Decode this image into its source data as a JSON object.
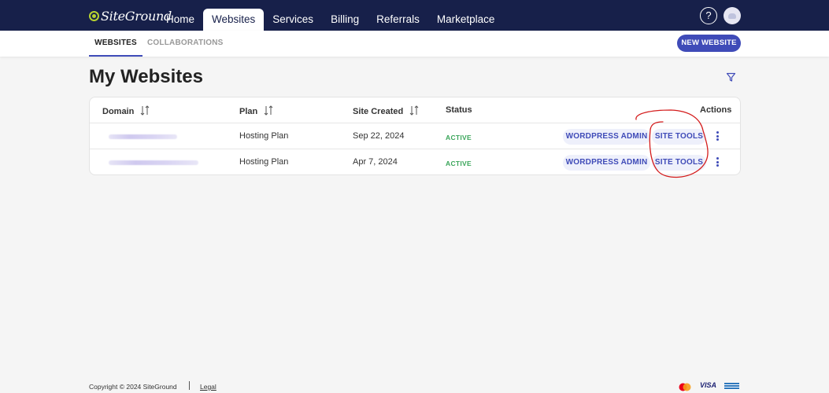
{
  "brand": {
    "name": "SiteGround"
  },
  "nav": {
    "items": [
      {
        "label": "Home",
        "active": false
      },
      {
        "label": "Websites",
        "active": true
      },
      {
        "label": "Services",
        "active": false
      },
      {
        "label": "Billing",
        "active": false
      },
      {
        "label": "Referrals",
        "active": false
      },
      {
        "label": "Marketplace",
        "active": false
      }
    ],
    "help_icon": "question-circle-icon",
    "help_glyph": "?",
    "avatar_icon": "user-avatar-icon"
  },
  "subnav": {
    "tabs": [
      {
        "label": "WEBSITES",
        "active": true
      },
      {
        "label": "COLLABORATIONS",
        "active": false
      }
    ],
    "new_button": "NEW WEBSITE"
  },
  "page": {
    "title": "My Websites",
    "filter_icon": "filter-icon"
  },
  "table": {
    "headers": {
      "domain": "Domain",
      "plan": "Plan",
      "created": "Site Created",
      "status": "Status",
      "actions": "Actions"
    },
    "rows": [
      {
        "domain": "",
        "plan": "Hosting Plan",
        "created": "Sep 22, 2024",
        "status": "ACTIVE",
        "wp_admin": "WORDPRESS ADMIN",
        "site_tools": "SITE TOOLS"
      },
      {
        "domain": "",
        "plan": "Hosting Plan",
        "created": "Apr 7, 2024",
        "status": "ACTIVE",
        "wp_admin": "WORDPRESS ADMIN",
        "site_tools": "SITE TOOLS"
      }
    ]
  },
  "footer": {
    "copyright": "Copyright © 2024 SiteGround",
    "legal": "Legal",
    "payment_icons": [
      "mastercard-icon",
      "visa-icon",
      "amex-icon"
    ],
    "visa_text": "VISA"
  },
  "colors": {
    "topbar": "#17204a",
    "accent": "#3f4bb8",
    "status_active": "#3aa55a",
    "annotation": "#d41c1c"
  }
}
